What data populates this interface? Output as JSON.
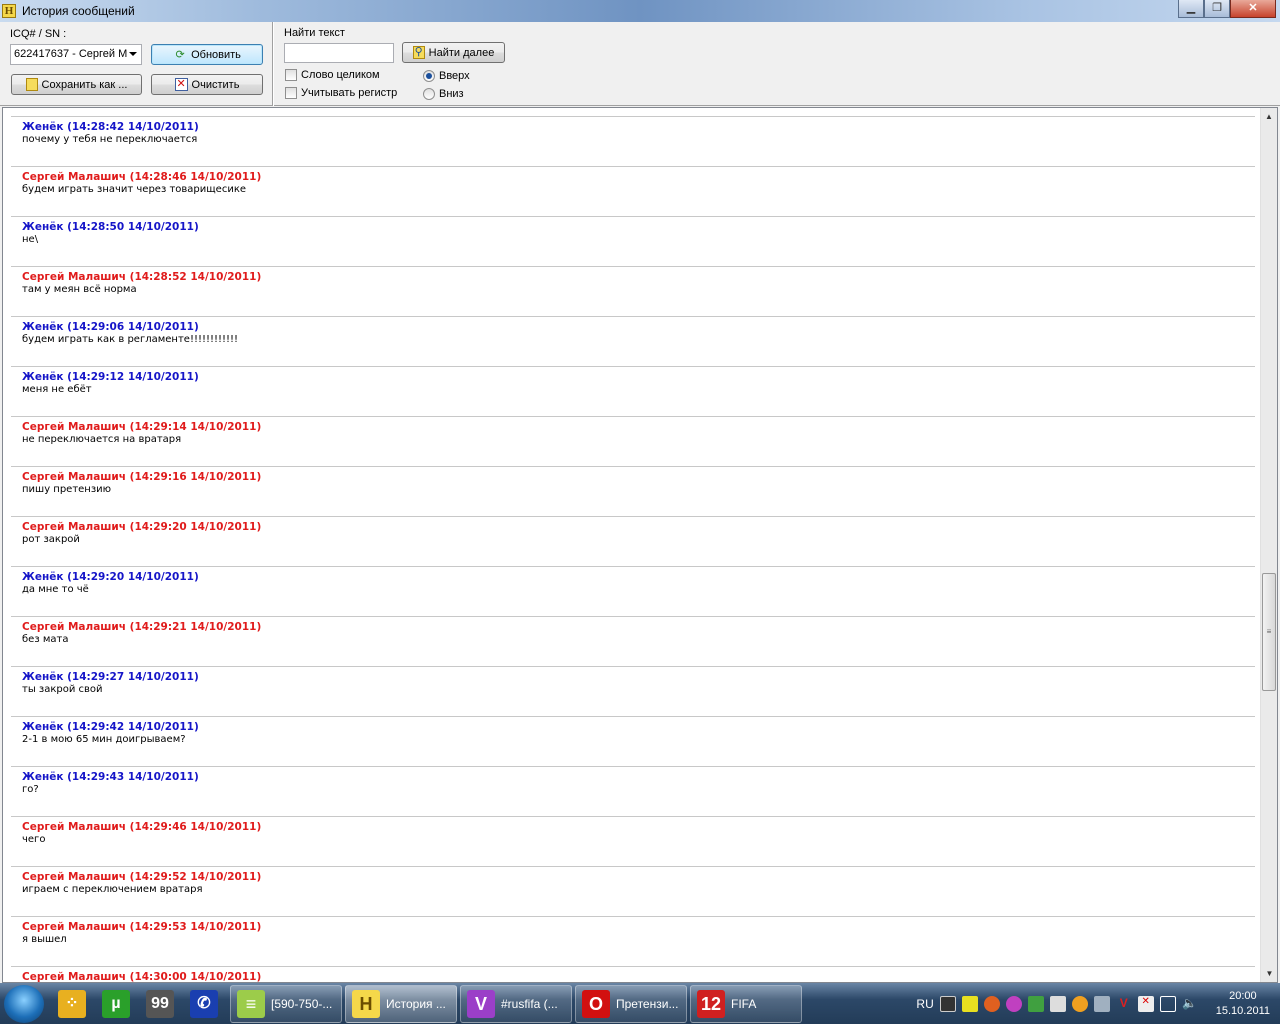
{
  "window": {
    "title": "История сообщений",
    "icon_letter": "H"
  },
  "toolbar": {
    "icq_label": "ICQ# / SN :",
    "contact_value": "622417637 - Сергей М",
    "refresh_label": "Обновить",
    "save_label": "Сохранить как ...",
    "clear_label": "Очистить",
    "find_label": "Найти текст",
    "find_value": "",
    "find_next_label": "Найти далее",
    "whole_word_label": "Слово целиком",
    "match_case_label": "Учитывать регистр",
    "up_label": "Вверх",
    "down_label": "Вниз",
    "direction": "up"
  },
  "colors": {
    "me": "#1515c8",
    "other": "#e01b1b"
  },
  "messages": [
    {
      "author": "Женёк",
      "role": "me",
      "header": "Женёк (14:28:42 14/10/2011)",
      "text": "почему у тебя не переключается"
    },
    {
      "author": "Сергей Малашич",
      "role": "other",
      "header": "Сергей Малашич (14:28:46 14/10/2011)",
      "text": "будем играть значит через товарищесике"
    },
    {
      "author": "Женёк",
      "role": "me",
      "header": "Женёк (14:28:50 14/10/2011)",
      "text": "не\\"
    },
    {
      "author": "Сергей Малашич",
      "role": "other",
      "header": "Сергей Малашич (14:28:52 14/10/2011)",
      "text": "там у меян всё норма"
    },
    {
      "author": "Женёк",
      "role": "me",
      "header": "Женёк (14:29:06 14/10/2011)",
      "text": "будем играть как в регламенте!!!!!!!!!!!!"
    },
    {
      "author": "Женёк",
      "role": "me",
      "header": "Женёк (14:29:12 14/10/2011)",
      "text": "меня не ебёт"
    },
    {
      "author": "Сергей Малашич",
      "role": "other",
      "header": "Сергей Малашич (14:29:14 14/10/2011)",
      "text": "не переключается на вратаря"
    },
    {
      "author": "Сергей Малашич",
      "role": "other",
      "header": "Сергей Малашич (14:29:16 14/10/2011)",
      "text": "пишу претензию"
    },
    {
      "author": "Сергей Малашич",
      "role": "other",
      "header": "Сергей Малашич (14:29:20 14/10/2011)",
      "text": "рот закрой"
    },
    {
      "author": "Женёк",
      "role": "me",
      "header": "Женёк (14:29:20 14/10/2011)",
      "text": "да мне то чё"
    },
    {
      "author": "Сергей Малашич",
      "role": "other",
      "header": "Сергей Малашич (14:29:21 14/10/2011)",
      "text": "без мата"
    },
    {
      "author": "Женёк",
      "role": "me",
      "header": "Женёк (14:29:27 14/10/2011)",
      "text": "ты закрой свой"
    },
    {
      "author": "Женёк",
      "role": "me",
      "header": "Женёк (14:29:42 14/10/2011)",
      "text": "2-1 в мою 65 мин доигрываем?"
    },
    {
      "author": "Женёк",
      "role": "me",
      "header": "Женёк (14:29:43 14/10/2011)",
      "text": "го?"
    },
    {
      "author": "Сергей Малашич",
      "role": "other",
      "header": "Сергей Малашич (14:29:46 14/10/2011)",
      "text": "чего"
    },
    {
      "author": "Сергей Малашич",
      "role": "other",
      "header": "Сергей Малашич (14:29:52 14/10/2011)",
      "text": "играем с переключением вратаря"
    },
    {
      "author": "Сергей Малашич",
      "role": "other",
      "header": "Сергей Малашич (14:29:53 14/10/2011)",
      "text": "я вышел"
    },
    {
      "author": "Сергей Малашич",
      "role": "other",
      "header": "Сергей Малашич (14:30:00 14/10/2011)",
      "text": ""
    }
  ],
  "scroll": {
    "position_fraction": 0.62
  },
  "taskbar": {
    "tasks": [
      {
        "label": "[590-750-...",
        "icon": "notepad-icon",
        "glyph": "≡",
        "color": "#9ccc4a"
      },
      {
        "label": "История ...",
        "icon": "history-icon",
        "glyph": "H",
        "color": "#f5d84a",
        "active": true
      },
      {
        "label": "#rusfifa (...",
        "icon": "v-chat-icon",
        "glyph": "V",
        "color": "#9b3fc8"
      },
      {
        "label": "Претензи...",
        "icon": "opera-icon",
        "glyph": "O",
        "color": "#d21010"
      },
      {
        "label": "FIFA",
        "icon": "fifa12-icon",
        "glyph": "12",
        "color": "#d02020"
      }
    ],
    "pinned": [
      {
        "icon": "dots-app-icon",
        "glyph": "⁘",
        "color": "#e8b020"
      },
      {
        "icon": "utorrent-icon",
        "glyph": "µ",
        "color": "#2aa02a"
      },
      {
        "icon": "qip-monitor-icon",
        "glyph": "99",
        "color": "#555"
      },
      {
        "icon": "phone-app-icon",
        "glyph": "✆",
        "color": "#1a3fb0"
      }
    ],
    "language": "RU",
    "time": "20:00",
    "date": "15.10.2011"
  }
}
